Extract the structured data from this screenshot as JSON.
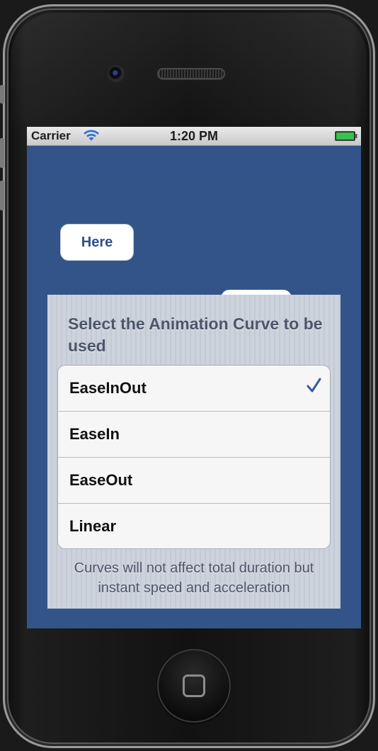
{
  "statusbar": {
    "carrier": "Carrier",
    "time": "1:20 PM",
    "icons": [
      "wifi-icon",
      "battery-icon"
    ],
    "battery_color": "#34c44a"
  },
  "screen": {
    "background_color": "#325489",
    "here_button_label": "Here"
  },
  "picker": {
    "header": "Select the Animation Curve to be used",
    "options": [
      {
        "label": "EaseInOut",
        "selected": true
      },
      {
        "label": "EaseIn",
        "selected": false
      },
      {
        "label": "EaseOut",
        "selected": false
      },
      {
        "label": "Linear",
        "selected": false
      }
    ],
    "footer": "Curves will not affect total duration but instant speed and acceleration",
    "accent_color": "#3b5a99"
  },
  "device": {
    "hardware": [
      "camera-icon",
      "speaker-grille",
      "home-button"
    ]
  }
}
